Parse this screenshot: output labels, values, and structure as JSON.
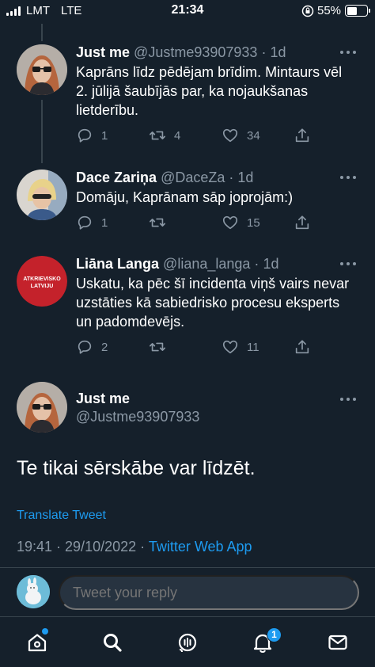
{
  "status_bar": {
    "carrier": "LMT",
    "network": "LTE",
    "time": "21:34",
    "battery_percent": "55%",
    "battery_level": 0.55
  },
  "replies": [
    {
      "name": "Just me",
      "handle": "@Justme93907933",
      "separator": "·",
      "time": "1d",
      "text": "Kaprāns līdz pēdējam brīdim. Mintaurs vēl 2. jūlijā šaubījās par, ka nojaukšanas lietderību.",
      "replies": "1",
      "retweets": "4",
      "likes": "34"
    },
    {
      "name": "Dace Zariņa",
      "handle": "@DaceZa",
      "separator": "·",
      "time": "1d",
      "text": "Domāju, Kaprānam sāp joprojām:)",
      "replies": "1",
      "retweets": "",
      "likes": "15"
    },
    {
      "name": "Liāna Langa",
      "handle": "@liana_langa",
      "separator": "·",
      "time": "1d",
      "avatar_logo": [
        "ATKRIEVISKO",
        "LATVIJU"
      ],
      "text": "Uskatu, ka pēc šī incidenta viņš vairs nevar uzstāties kā sabiedrisko procesu eksperts un padomdevējs.",
      "replies": "2",
      "retweets": "",
      "likes": "11"
    }
  ],
  "main_tweet": {
    "name": "Just me",
    "handle": "@Justme93907933",
    "text": "Te tikai sērskābe var līdzēt.",
    "translate_label": "Translate Tweet",
    "timestamp": "19:41 · 29/10/2022 · ",
    "source": "Twitter Web App"
  },
  "composer": {
    "placeholder": "Tweet your reply"
  },
  "tabbar": {
    "notifications_count": "1",
    "items": [
      "home-icon",
      "search-icon",
      "spaces-icon",
      "notifications-icon",
      "messages-icon"
    ]
  },
  "colors": {
    "background": "#15202b",
    "accent": "#1d9bf0",
    "secondary_text": "#8b98a5",
    "divider": "#38444d"
  }
}
